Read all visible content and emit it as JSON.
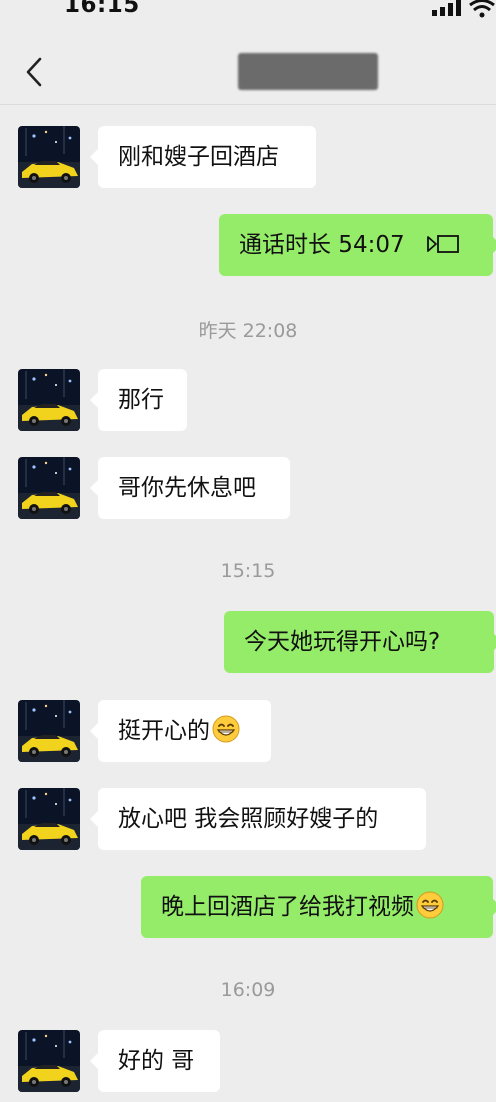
{
  "status": {
    "time": "16:15"
  },
  "header": {
    "back_icon": "chevron-left-icon",
    "title_redacted": true
  },
  "messages": [
    {
      "side": "in",
      "text": "刚和嫂子回酒店"
    },
    {
      "side": "out",
      "text": "通话时长 54:07",
      "icon": "video-call-icon"
    },
    {
      "side": "in",
      "text": "那行"
    },
    {
      "side": "in",
      "text": "哥你先休息吧"
    },
    {
      "side": "out",
      "text": "今天她玩得开心吗?"
    },
    {
      "side": "in",
      "text": "挺开心的",
      "icon": "grin-emoji-icon"
    },
    {
      "side": "in",
      "text": "放心吧 我会照顾好嫂子的"
    },
    {
      "side": "out",
      "text": "晚上回酒店了给我打视频",
      "icon": "grin-emoji-icon"
    },
    {
      "side": "in",
      "text": "好的 哥"
    }
  ],
  "timestamps": [
    "昨天 22:08",
    "15:15",
    "16:09"
  ],
  "colors": {
    "background": "#ededed",
    "incoming_bubble": "#ffffff",
    "outgoing_bubble": "#95ec69",
    "timestamp_text": "#9a9a9a"
  }
}
